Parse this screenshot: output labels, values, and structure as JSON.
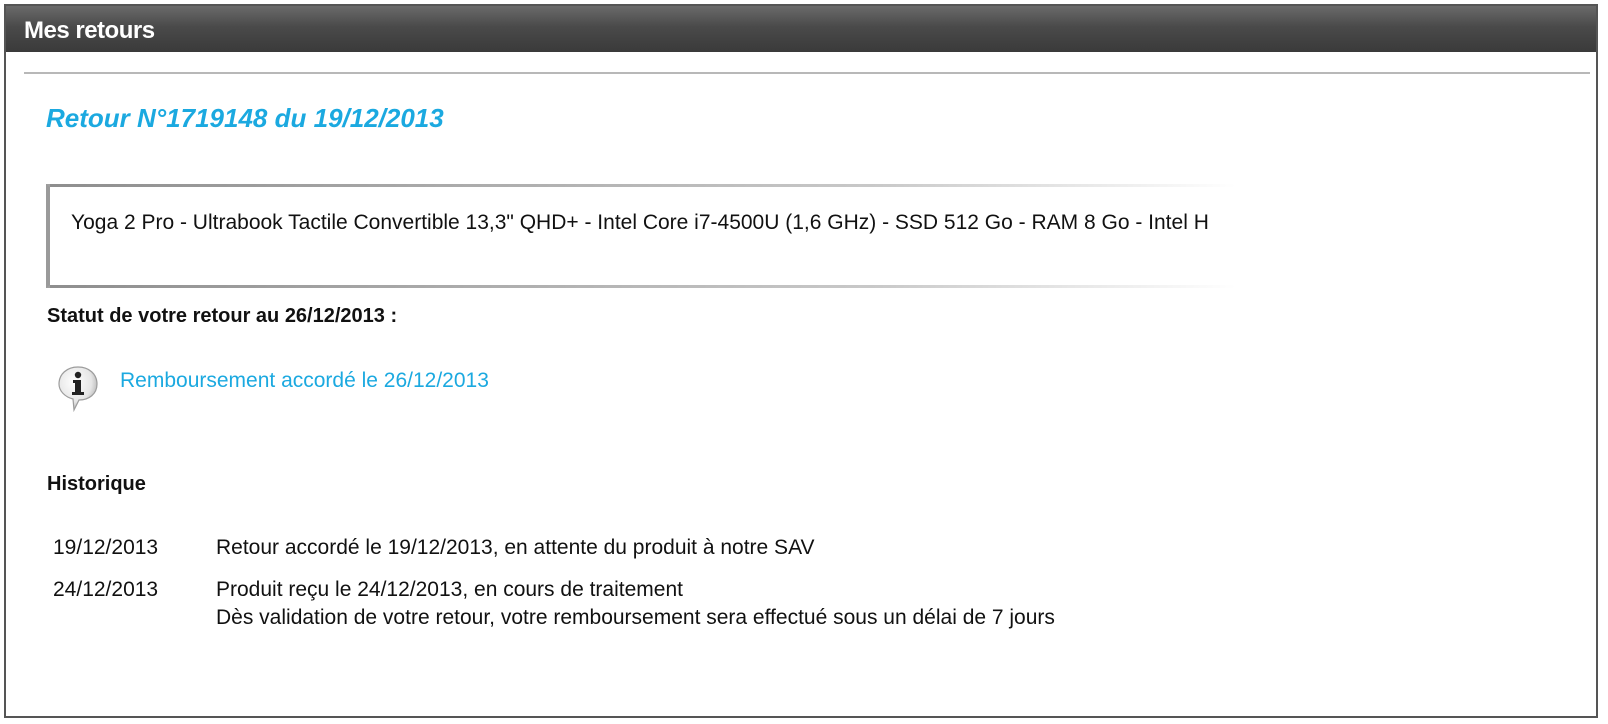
{
  "header": {
    "title": "Mes retours"
  },
  "return": {
    "title": "Retour N°1719148 du 19/12/2013"
  },
  "product": {
    "description": "Yoga 2 Pro - Ultrabook Tactile Convertible 13,3\" QHD+ - Intel Core i7-4500U (1,6 GHz) - SSD 512 Go - RAM 8 Go - Intel H"
  },
  "status": {
    "heading": "Statut de votre retour au 26/12/2013 :",
    "icon": "info-icon",
    "text": "Remboursement accordé le 26/12/2013"
  },
  "history": {
    "heading": "Historique",
    "rows": [
      {
        "date": "19/12/2013",
        "lines": [
          "Retour accordé le 19/12/2013, en attente du produit à notre SAV"
        ]
      },
      {
        "date": "24/12/2013",
        "lines": [
          "Produit reçu le 24/12/2013, en cours de traitement",
          "Dès validation de votre retour, votre remboursement sera effectué sous un délai de 7 jours"
        ]
      }
    ]
  },
  "colors": {
    "accent": "#1ba9e0",
    "header_bg": "#4a4a4a"
  }
}
